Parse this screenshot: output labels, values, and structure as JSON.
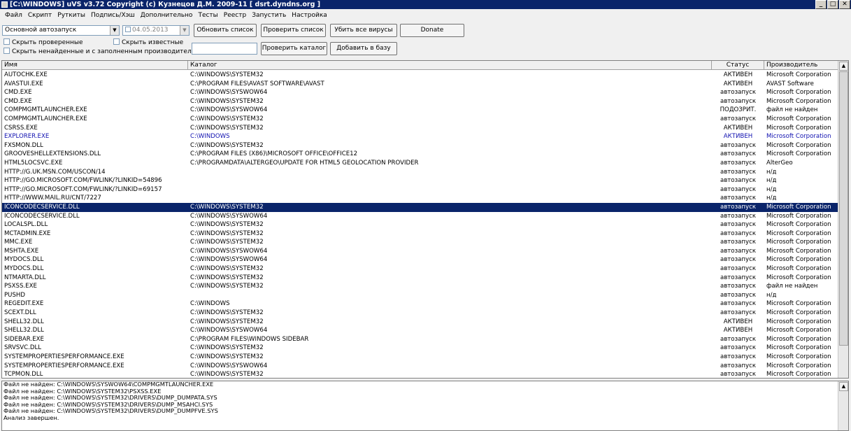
{
  "window": {
    "title": "[C:\\WINDOWS] uVS v3.72 Copyright (c) Кузнецов Д.М. 2009-11 [ dsrt.dyndns.org ]",
    "minimize": "_",
    "maximize": "□",
    "close": "✕"
  },
  "menu": [
    "Файл",
    "Скрипт",
    "Руткиты",
    "Подпись/Хэш",
    "Дополнительно",
    "Тесты",
    "Реестр",
    "Запустить",
    "Настройка"
  ],
  "toolbar": {
    "category_select": "Основной автозапуск",
    "date_value": "04.05.2013",
    "refresh_label": "Обновить список",
    "check_list_label": "Проверить список",
    "kill_all_label": "Убить все вирусы",
    "donate_label": "Donate",
    "hide_checked_label": "Скрыть проверенные",
    "hide_known_label": "Скрыть известные",
    "hide_notfound_label": "Скрыть ненайденные и с заполненным производителем",
    "check_dir_label": "Проверить каталог",
    "add_db_label": "Добавить в базу"
  },
  "table": {
    "headers": {
      "name": "Имя",
      "dir": "Каталог",
      "status": "Статус",
      "vendor": "Производитель"
    },
    "selected_index": 15,
    "rows": [
      {
        "name": "AUTOCHK.EXE",
        "dir": "C:\\WINDOWS\\SYSTEM32",
        "status": "АКТИВЕН",
        "vendor": "Microsoft Corporation"
      },
      {
        "name": "AVASTUI.EXE",
        "dir": "C:\\PROGRAM FILES\\AVAST SOFTWARE\\AVAST",
        "status": "АКТИВЕН",
        "vendor": "AVAST Software"
      },
      {
        "name": "CMD.EXE",
        "dir": "C:\\WINDOWS\\SYSWOW64",
        "status": "автозапуск",
        "vendor": "Microsoft Corporation"
      },
      {
        "name": "CMD.EXE",
        "dir": "C:\\WINDOWS\\SYSTEM32",
        "status": "автозапуск",
        "vendor": "Microsoft Corporation"
      },
      {
        "name": "COMPMGMTLAUNCHER.EXE",
        "dir": "C:\\WINDOWS\\SYSWOW64",
        "status": "ПОДОЗРИТ.",
        "vendor": "файл не найден"
      },
      {
        "name": "COMPMGMTLAUNCHER.EXE",
        "dir": "C:\\WINDOWS\\SYSTEM32",
        "status": "автозапуск",
        "vendor": "Microsoft Corporation"
      },
      {
        "name": "CSRSS.EXE",
        "dir": "C:\\WINDOWS\\SYSTEM32",
        "status": "АКТИВЕН",
        "vendor": "Microsoft Corporation"
      },
      {
        "name": "EXPLORER.EXE",
        "dir": "C:\\WINDOWS",
        "status": "АКТИВЕН",
        "vendor": "Microsoft Corporation",
        "blue": true
      },
      {
        "name": "FXSMON.DLL",
        "dir": "C:\\WINDOWS\\SYSTEM32",
        "status": "автозапуск",
        "vendor": "Microsoft Corporation"
      },
      {
        "name": "GROOVESHELLEXTENSIONS.DLL",
        "dir": "C:\\PROGRAM FILES (X86)\\MICROSOFT OFFICE\\OFFICE12",
        "status": "автозапуск",
        "vendor": "Microsoft Corporation"
      },
      {
        "name": "HTML5LOCSVC.EXE",
        "dir": "C:\\PROGRAMDATA\\ALTERGEO\\UPDATE FOR HTML5 GEOLOCATION PROVIDER",
        "status": "автозапуск",
        "vendor": "AlterGeo"
      },
      {
        "name": "HTTP://G.UK.MSN.COM/USCON/14",
        "dir": "",
        "status": "автозапуск",
        "vendor": "н/д"
      },
      {
        "name": "HTTP://GO.MICROSOFT.COM/FWLINK/?LINKID=54896",
        "dir": "",
        "status": "автозапуск",
        "vendor": "н/д"
      },
      {
        "name": "HTTP://GO.MICROSOFT.COM/FWLINK/?LINKID=69157",
        "dir": "",
        "status": "автозапуск",
        "vendor": "н/д"
      },
      {
        "name": "HTTP://WWW.MAIL.RU/CNT/7227",
        "dir": "",
        "status": "автозапуск",
        "vendor": "н/д"
      },
      {
        "name": "ICONCODECSERVICE.DLL",
        "dir": "C:\\WINDOWS\\SYSTEM32",
        "status": "автозапуск",
        "vendor": "Microsoft Corporation"
      },
      {
        "name": "ICONCODECSERVICE.DLL",
        "dir": "C:\\WINDOWS\\SYSWOW64",
        "status": "автозапуск",
        "vendor": "Microsoft Corporation"
      },
      {
        "name": "LOCALSPL.DLL",
        "dir": "C:\\WINDOWS\\SYSTEM32",
        "status": "автозапуск",
        "vendor": "Microsoft Corporation"
      },
      {
        "name": "MCTADMIN.EXE",
        "dir": "C:\\WINDOWS\\SYSTEM32",
        "status": "автозапуск",
        "vendor": "Microsoft Corporation"
      },
      {
        "name": "MMC.EXE",
        "dir": "C:\\WINDOWS\\SYSTEM32",
        "status": "автозапуск",
        "vendor": "Microsoft Corporation"
      },
      {
        "name": "MSHTA.EXE",
        "dir": "C:\\WINDOWS\\SYSWOW64",
        "status": "автозапуск",
        "vendor": "Microsoft Corporation"
      },
      {
        "name": "MYDOCS.DLL",
        "dir": "C:\\WINDOWS\\SYSWOW64",
        "status": "автозапуск",
        "vendor": "Microsoft Corporation"
      },
      {
        "name": "MYDOCS.DLL",
        "dir": "C:\\WINDOWS\\SYSTEM32",
        "status": "автозапуск",
        "vendor": "Microsoft Corporation"
      },
      {
        "name": "NTMARTA.DLL",
        "dir": "C:\\WINDOWS\\SYSTEM32",
        "status": "автозапуск",
        "vendor": "Microsoft Corporation"
      },
      {
        "name": "PSXSS.EXE",
        "dir": "C:\\WINDOWS\\SYSTEM32",
        "status": "автозапуск",
        "vendor": "файл не найден"
      },
      {
        "name": "PUSHD",
        "dir": "",
        "status": "автозапуск",
        "vendor": "н/д"
      },
      {
        "name": "REGEDIT.EXE",
        "dir": "C:\\WINDOWS",
        "status": "автозапуск",
        "vendor": "Microsoft Corporation"
      },
      {
        "name": "SCEXT.DLL",
        "dir": "C:\\WINDOWS\\SYSTEM32",
        "status": "автозапуск",
        "vendor": "Microsoft Corporation"
      },
      {
        "name": "SHELL32.DLL",
        "dir": "C:\\WINDOWS\\SYSTEM32",
        "status": "АКТИВЕН",
        "vendor": "Microsoft Corporation"
      },
      {
        "name": "SHELL32.DLL",
        "dir": "C:\\WINDOWS\\SYSWOW64",
        "status": "АКТИВЕН",
        "vendor": "Microsoft Corporation"
      },
      {
        "name": "SIDEBAR.EXE",
        "dir": "C:\\PROGRAM FILES\\WINDOWS SIDEBAR",
        "status": "автозапуск",
        "vendor": "Microsoft Corporation"
      },
      {
        "name": "SRVSVC.DLL",
        "dir": "C:\\WINDOWS\\SYSTEM32",
        "status": "автозапуск",
        "vendor": "Microsoft Corporation"
      },
      {
        "name": "SYSTEMPROPERTIESPERFORMANCE.EXE",
        "dir": "C:\\WINDOWS\\SYSTEM32",
        "status": "автозапуск",
        "vendor": "Microsoft Corporation"
      },
      {
        "name": "SYSTEMPROPERTIESPERFORMANCE.EXE",
        "dir": "C:\\WINDOWS\\SYSWOW64",
        "status": "автозапуск",
        "vendor": "Microsoft Corporation"
      },
      {
        "name": "TCPMON.DLL",
        "dir": "C:\\WINDOWS\\SYSTEM32",
        "status": "автозапуск",
        "vendor": "Microsoft Corporation"
      }
    ]
  },
  "log": [
    "Файл не найден: C:\\WINDOWS\\SYSWOW64\\COMPMGMTLAUNCHER.EXE",
    "Файл не найден: C:\\WINDOWS\\SYSTEM32\\PSXSS.EXE",
    "Файл не найден: C:\\WINDOWS\\SYSTEM32\\DRIVERS\\DUMP_DUMPATA.SYS",
    "Файл не найден: C:\\WINDOWS\\SYSTEM32\\DRIVERS\\DUMP_MSAHCI.SYS",
    "Файл не найден: C:\\WINDOWS\\SYSTEM32\\DRIVERS\\DUMP_DUMPFVE.SYS",
    "Анализ завершен."
  ],
  "scroll": {
    "up": "▲",
    "down": "▼"
  },
  "colors": {
    "selection": "#0a246a",
    "titlebar": "#0a246a",
    "highlight_text": "#1010b0"
  }
}
